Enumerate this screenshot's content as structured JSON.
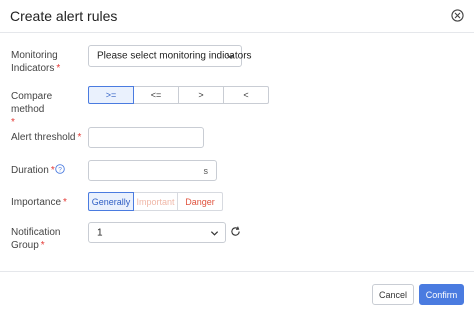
{
  "dialog": {
    "title": "Create alert rules"
  },
  "form": {
    "monitoring_indicators": {
      "label": "Monitoring Indicators",
      "required_mark": "*",
      "value": "Please select monitoring indicators"
    },
    "compare_method": {
      "label": "Compare method",
      "required_mark": "*",
      "options": [
        ">=",
        "<=",
        ">",
        "<"
      ],
      "selected": ">="
    },
    "alert_threshold": {
      "label": "Alert threshold",
      "required_mark": "*",
      "value": ""
    },
    "duration": {
      "label": "Duration",
      "required_mark": "*",
      "value": "",
      "suffix": "s"
    },
    "importance": {
      "label": "Importance",
      "required_mark": "*",
      "options": [
        "Generally",
        "Important",
        "Danger"
      ],
      "selected": "Generally",
      "colors": {
        "generally": "#2f5fc4",
        "important": "#f0b8a8",
        "danger": "#e0533e"
      }
    },
    "notification_group": {
      "label": "Notification Group",
      "required_mark": "*",
      "value": "1"
    }
  },
  "footer": {
    "cancel_label": "Cancel",
    "confirm_label": "Confirm"
  },
  "colors": {
    "accent": "#4a7be0",
    "required": "#e53935"
  }
}
